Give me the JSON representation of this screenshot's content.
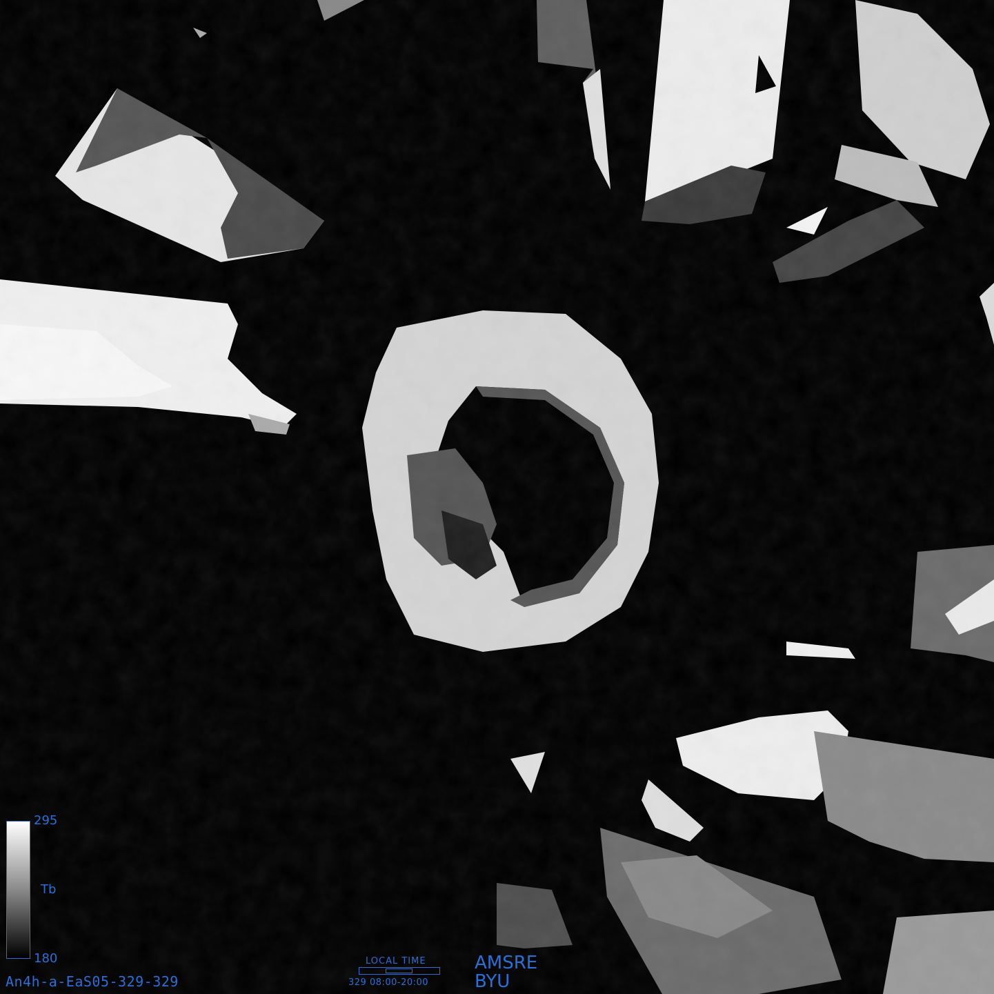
{
  "legend": {
    "max_label": "295",
    "unit_label": "Tb",
    "min_label": "180",
    "colormap": [
      "#000000",
      "#ffffff"
    ],
    "text_color": "#2b6fd6"
  },
  "image_id": "An4h-a-EaS05-329-329",
  "local_time": {
    "title": "LOCAL TIME",
    "range_text": "329 08:00-20:00",
    "fill_fraction": [
      0.33,
      0.67
    ]
  },
  "credits": {
    "sensor": "AMSRE",
    "org": "BYU"
  }
}
